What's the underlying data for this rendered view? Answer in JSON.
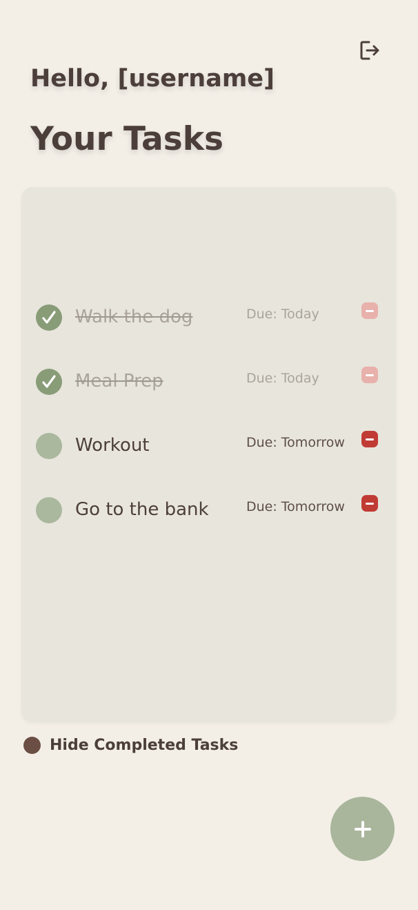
{
  "header": {
    "greeting": "Hello, [username]",
    "title": "Your Tasks",
    "logout_icon": "logout-icon"
  },
  "tasks": [
    {
      "name": "Walk the dog",
      "due": "Due: Today",
      "completed": true
    },
    {
      "name": "Meal Prep",
      "due": "Due: Today",
      "completed": true
    },
    {
      "name": "Workout",
      "due": "Due: Tomorrow",
      "completed": false
    },
    {
      "name": "Go to the bank",
      "due": "Due: Tomorrow",
      "completed": false
    }
  ],
  "footer": {
    "hide_completed_label": "Hide Completed Tasks",
    "add_icon": "plus-icon"
  },
  "colors": {
    "background": "#f3efe7",
    "panel": "#e8e5dc",
    "text": "#4c3f3a",
    "check_done": "#889c78",
    "check_pending": "#aab89d",
    "delete": "#c13b35",
    "delete_faded": "#e8b1ab",
    "fab": "#a9b69c",
    "toggle": "#6b4e44"
  }
}
